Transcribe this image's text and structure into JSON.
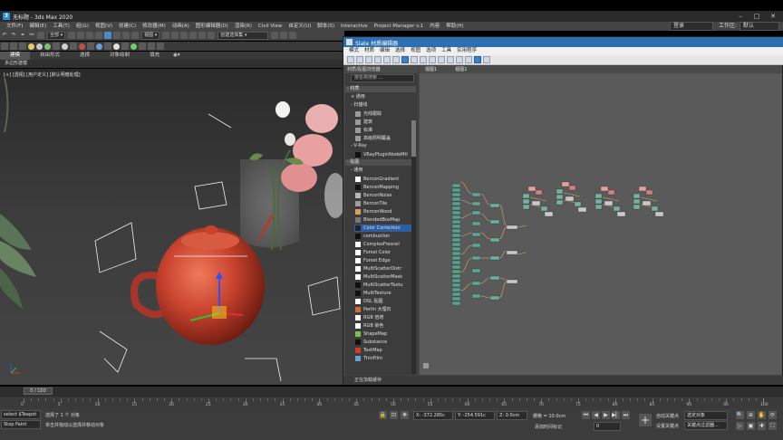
{
  "window": {
    "title": "无标题 - 3ds Max 2020",
    "logo": "3",
    "min": "–",
    "max": "□",
    "close": "✕"
  },
  "menus": [
    "文件(F)",
    "编辑(E)",
    "工具(T)",
    "组(G)",
    "视图(V)",
    "创建(C)",
    "修改器(M)",
    "动画(A)",
    "图形编辑器(D)",
    "渲染(R)",
    "Civil View",
    "自定义(U)",
    "脚本(S)",
    "Interactive",
    "Project Manager v.1",
    "内容",
    "帮助(H)"
  ],
  "workspace": {
    "user": "登录",
    "label": "工作区:",
    "value": "默认"
  },
  "toolbar": {
    "filter": "全部",
    "view": "视图",
    "selset": "创建选择集"
  },
  "ribbon": {
    "tabs": [
      "建模",
      "自由形式",
      "选择",
      "对象绘制",
      "填充"
    ],
    "sub": "多边形建模"
  },
  "viewport": {
    "label": "[+] [透视] [用户定义] [默认明暗处理]"
  },
  "slate": {
    "title": "Slate 材质编辑器",
    "menus": [
      "模式",
      "材质",
      "编辑",
      "选择",
      "视图",
      "选项",
      "工具",
      "实用程序"
    ],
    "browser_title": "材质/贴图浏览器",
    "search_placeholder": "按名称搜索 ...",
    "view_tabs": [
      "视图1",
      "视图1"
    ],
    "status": "正在加载缓存",
    "tree": [
      {
        "label": "- 材质",
        "type": "hdr"
      },
      {
        "label": "+ 通用",
        "type": "sub"
      },
      {
        "label": "- 扫描线",
        "type": "sub"
      },
      {
        "label": "光线跟踪",
        "type": "item",
        "color": "#9a9a9a"
      },
      {
        "label": "建筑",
        "type": "item",
        "color": "#9a9a9a"
      },
      {
        "label": "标准",
        "type": "item",
        "color": "#9a9a9a"
      },
      {
        "label": "高级照明覆盖",
        "type": "item",
        "color": "#9a9a9a"
      },
      {
        "label": "- V-Ray",
        "type": "sub"
      },
      {
        "label": "VRayPluginNodeMtl",
        "type": "item",
        "color": "#111111"
      },
      {
        "label": "- 贴图",
        "type": "hdr"
      },
      {
        "label": "- 通用",
        "type": "sub"
      },
      {
        "label": "BerconGradient",
        "type": "item",
        "color": "#ffffff"
      },
      {
        "label": "BerconMapping",
        "type": "item",
        "color": "#111111"
      },
      {
        "label": "BerconNoise",
        "type": "item",
        "color": "#b7b7b7"
      },
      {
        "label": "BerconTile",
        "type": "item",
        "color": "#9c9c9c"
      },
      {
        "label": "BerconWood",
        "type": "item",
        "color": "#d7a060"
      },
      {
        "label": "BlendedBoxMap",
        "type": "item",
        "color": "#777777"
      },
      {
        "label": "Color Correction",
        "type": "item",
        "color": "#222222",
        "selected": true
      },
      {
        "label": "combustion",
        "type": "item",
        "color": "#111111"
      },
      {
        "label": "ComplexFresnel",
        "type": "item",
        "color": "#ffffff"
      },
      {
        "label": "Forest Color",
        "type": "item",
        "color": "#ffffff"
      },
      {
        "label": "Forest Edge",
        "type": "item",
        "color": "#ffffff"
      },
      {
        "label": "MultiScatterDistr",
        "type": "item",
        "color": "#ffffff"
      },
      {
        "label": "MultiScatterMask",
        "type": "item",
        "color": "#ffffff"
      },
      {
        "label": "MultiScatterTextu",
        "type": "item",
        "color": "#111111"
      },
      {
        "label": "MultiTexture",
        "type": "item",
        "color": "#111111"
      },
      {
        "label": "OSL 贴图",
        "type": "item",
        "color": "#ffffff"
      },
      {
        "label": "Perlin 大理石",
        "type": "item",
        "color": "#d86a3a"
      },
      {
        "label": "RGB 倍增",
        "type": "item",
        "color": "#ffffff"
      },
      {
        "label": "RGB 染色",
        "type": "item",
        "color": "#ffffff"
      },
      {
        "label": "ShapeMap",
        "type": "item",
        "color": "#7dbd5a"
      },
      {
        "label": "Substance",
        "type": "item",
        "color": "#111111"
      },
      {
        "label": "TextMap",
        "type": "item",
        "color": "#d43a2a"
      },
      {
        "label": "ThinFilm",
        "type": "item",
        "color": "#6aa0d8"
      }
    ]
  },
  "timeline": {
    "frame": "0 / 100",
    "ticks": [
      "0",
      "5",
      "10",
      "15",
      "20",
      "25",
      "30",
      "35",
      "40",
      "45",
      "50",
      "55",
      "60",
      "65",
      "70",
      "75",
      "80",
      "85",
      "90",
      "95",
      "100"
    ]
  },
  "status": {
    "script1": "select $Teapot",
    "script2": "Stop Paint",
    "selected": "选择了 1 个 对象",
    "hint": "单击并拖动以选择并移动对象",
    "x": "X: -372.285c",
    "y": "Y: -254.591c",
    "z": "Z: 0.0cm",
    "grid": "栅格 = 10.0cm",
    "addtime": "添加时间标记",
    "autokey": "自动关键点",
    "setkey": "设置关键点",
    "selobj": "选定对象",
    "keyfilter": "关键点过滤器...",
    "frame": "0"
  },
  "colors": {
    "accent": "#2b6fb0",
    "teapot": "#c8422e",
    "flower": "#e8a0a0"
  }
}
